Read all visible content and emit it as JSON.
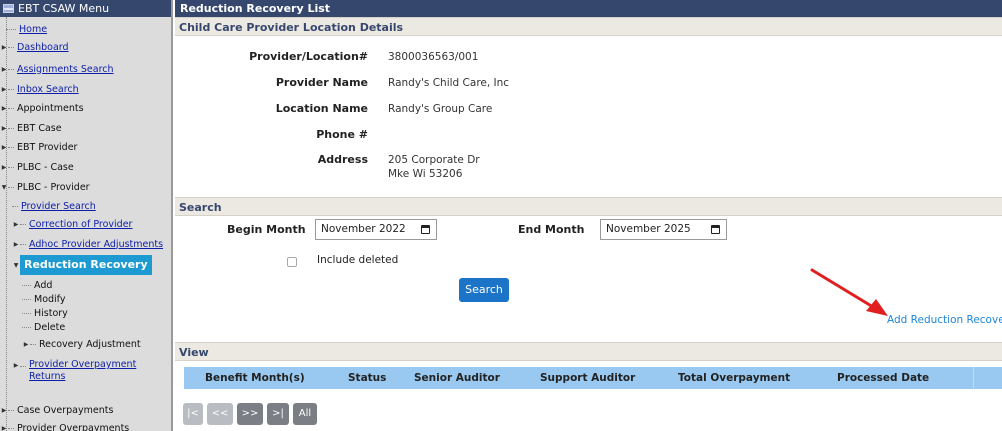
{
  "sidebar": {
    "title": "EBT CSAW Menu",
    "items": [
      {
        "label": "Home"
      },
      {
        "label": "Dashboard"
      },
      {
        "label": "Assignments Search"
      },
      {
        "label": "Inbox Search"
      },
      {
        "label": "Appointments"
      },
      {
        "label": "EBT Case"
      },
      {
        "label": "EBT Provider"
      },
      {
        "label": "PLBC - Case"
      },
      {
        "label": "PLBC - Provider"
      },
      {
        "label": "Provider Search"
      },
      {
        "label": "Correction of Provider"
      },
      {
        "label": "Adhoc Provider Adjustments"
      },
      {
        "label": "Reduction Recovery"
      },
      {
        "label": "Add"
      },
      {
        "label": "Modify"
      },
      {
        "label": "History"
      },
      {
        "label": "Delete"
      },
      {
        "label": "Recovery Adjustment"
      },
      {
        "label": "Provider Overpayment Returns"
      },
      {
        "label": "Case Overpayments"
      },
      {
        "label": "Provider Overpayments"
      }
    ]
  },
  "main": {
    "title": "Reduction Recovery List",
    "details": {
      "heading": "Child Care Provider Location Details",
      "provider_location_label": "Provider/Location#",
      "provider_location_value": "3800036563/001",
      "provider_name_label": "Provider Name",
      "provider_name_value": "Randy's Child Care, Inc",
      "location_name_label": "Location Name",
      "location_name_value": "Randy's Group Care",
      "phone_label": "Phone #",
      "phone_value": "",
      "address_label": "Address",
      "address_line1": "205 Corporate Dr",
      "address_line2": "Mke Wi 53206"
    },
    "search": {
      "heading": "Search",
      "begin_month_label": "Begin Month",
      "begin_month_value": "November 2022",
      "end_month_label": "End Month",
      "end_month_value": "November 2025",
      "include_deleted_label": "Include deleted",
      "include_deleted_checked": false,
      "search_button": "Search",
      "add_link": "Add Reduction Recover"
    },
    "view": {
      "heading": "View",
      "columns": [
        "Benefit Month(s)",
        "Status",
        "Senior Auditor",
        "Support Auditor",
        "Total Overpayment",
        "Processed Date"
      ],
      "rows": [],
      "pager": [
        "|<",
        "<<",
        ">>",
        ">|",
        "All"
      ]
    }
  },
  "colors": {
    "header_bg": "#36476e",
    "section_bg": "#ece9e2",
    "active_item_bg": "#1e9ad2",
    "button_bg": "#1b74c8",
    "grid_header_bg": "#99c9f0",
    "link_blue": "#1f86d6",
    "annotation_arrow": "#e02020"
  }
}
